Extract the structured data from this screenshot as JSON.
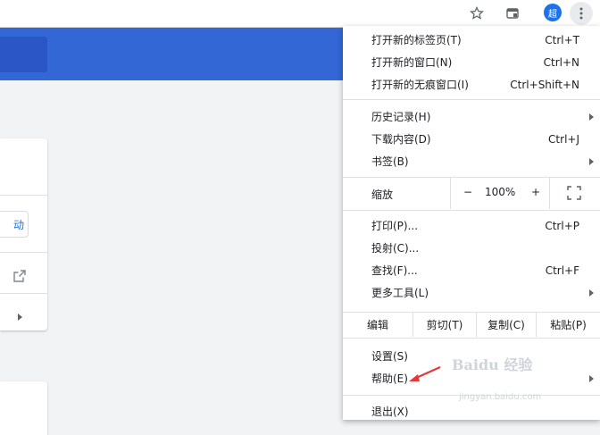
{
  "toolbar": {
    "avatar_text": "超"
  },
  "left_card": {
    "button_fragment": "动"
  },
  "menu": {
    "new_tab": {
      "label": "打开新的标签页(T)",
      "shortcut": "Ctrl+T"
    },
    "new_window": {
      "label": "打开新的窗口(N)",
      "shortcut": "Ctrl+N"
    },
    "new_incognito": {
      "label": "打开新的无痕窗口(I)",
      "shortcut": "Ctrl+Shift+N"
    },
    "history": {
      "label": "历史记录(H)"
    },
    "downloads": {
      "label": "下载内容(D)",
      "shortcut": "Ctrl+J"
    },
    "bookmarks": {
      "label": "书签(B)"
    },
    "zoom": {
      "label": "缩放",
      "minus": "−",
      "value": "100%",
      "plus": "+"
    },
    "print": {
      "label": "打印(P)...",
      "shortcut": "Ctrl+P"
    },
    "cast": {
      "label": "投射(C)..."
    },
    "find": {
      "label": "查找(F)...",
      "shortcut": "Ctrl+F"
    },
    "more_tools": {
      "label": "更多工具(L)"
    },
    "edit": {
      "label": "编辑",
      "cut": "剪切(T)",
      "copy": "复制(C)",
      "paste": "粘贴(P)"
    },
    "settings": {
      "label": "设置(S)"
    },
    "help": {
      "label": "帮助(E)"
    },
    "exit": {
      "label": "退出(X)"
    }
  },
  "watermark": {
    "text": "Baidu 经验",
    "sub": "jingyan.baidu.com"
  },
  "colors": {
    "header_blue": "#3367d6",
    "accent": "#1a73e8",
    "arrow_red": "#e53935"
  }
}
